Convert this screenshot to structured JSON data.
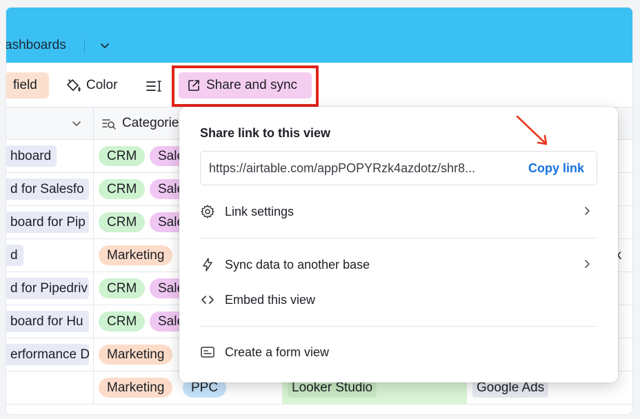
{
  "topbar": {
    "breadcrumb": "ashboards"
  },
  "toolbar": {
    "field_label": "field",
    "color_label": "Color",
    "share_label": "Share and sync"
  },
  "grid": {
    "category_header": "Categorie",
    "rows": [
      {
        "name": "hboard",
        "tags": [
          "CRM",
          "Sale"
        ]
      },
      {
        "name": "d for Salesfo",
        "tags": [
          "CRM",
          "Sale"
        ]
      },
      {
        "name": "board for Pip",
        "tags": [
          "CRM",
          "Sale"
        ]
      },
      {
        "name": "d",
        "tags": [
          "Marketing"
        ],
        "extra": "ok"
      },
      {
        "name": "d for Pipedriv",
        "tags": [
          "CRM",
          "Sale"
        ]
      },
      {
        "name": "board for Hu",
        "tags": [
          "CRM",
          "Sale"
        ]
      },
      {
        "name": "erformance D",
        "tags": [
          "Marketing"
        ]
      },
      {
        "name": "",
        "tags": [
          "Marketing",
          "PPC"
        ],
        "tool": "Looker Studio",
        "source": "Google Ads"
      }
    ]
  },
  "popover": {
    "title": "Share link to this view",
    "url": "https://airtable.com/appPOPYRzk4azdotz/shr8...",
    "copy_label": "Copy link",
    "link_settings": "Link settings",
    "sync_data": "Sync data to another base",
    "embed": "Embed this view",
    "create_form": "Create a form view"
  },
  "colors": {
    "topbar": "#3bc0f3",
    "share_button": "#f5cdf1",
    "highlight_box": "#e2231a",
    "copy_link": "#1672e0",
    "crm_pill": "#cdf2cf",
    "marketing_pill": "#fcdcc9",
    "sales_pill": "#f0c6f2",
    "ppc_pill": "#c6e3fb"
  }
}
